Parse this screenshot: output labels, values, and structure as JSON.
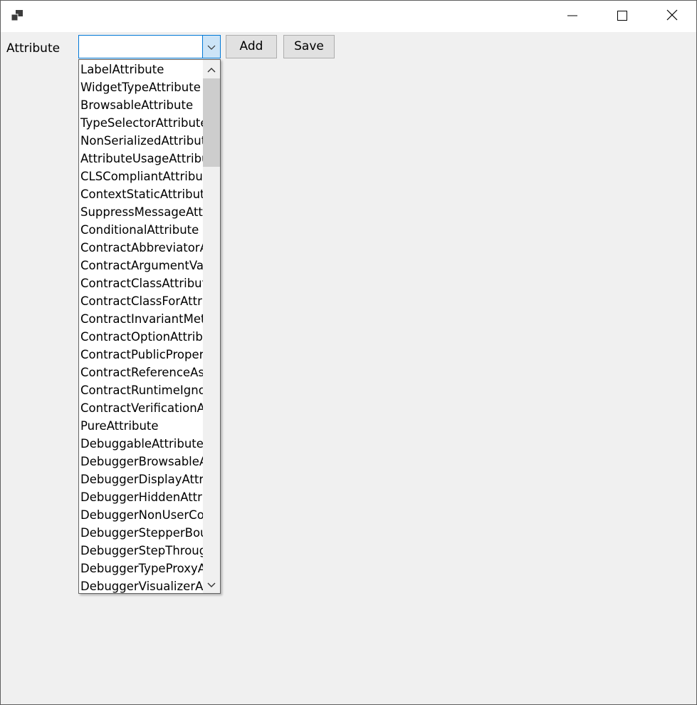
{
  "window": {
    "app_icon": "app-icon",
    "minimize_icon": "minimize-icon",
    "maximize_icon": "maximize-icon",
    "close_icon": "close-icon"
  },
  "form": {
    "attribute_label": "Attribute",
    "combo_value": "",
    "add_label": "Add",
    "save_label": "Save"
  },
  "dropdown": {
    "items": [
      "LabelAttribute",
      "WidgetTypeAttribute",
      "BrowsableAttribute",
      "TypeSelectorAttribute",
      "NonSerializedAttribut",
      "AttributeUsageAttribu",
      "CLSCompliantAttribut",
      "ContextStaticAttribute",
      "SuppressMessageAttr",
      "ConditionalAttribute",
      "ContractAbbreviatorA",
      "ContractArgumentVal",
      "ContractClassAttribute",
      "ContractClassForAttril",
      "ContractInvariantMeth",
      "ContractOptionAttribu",
      "ContractPublicPropert",
      "ContractReferenceAss",
      "ContractRuntimeIgno",
      "ContractVerificationAt",
      "PureAttribute",
      "DebuggableAttribute",
      "DebuggerBrowsableA",
      "DebuggerDisplayAttri",
      "DebuggerHiddenAttri",
      "DebuggerNonUserCo",
      "DebuggerStepperBou",
      "DebuggerStepThroug",
      "DebuggerTypeProxyA",
      "DebuggerVisualizerAt"
    ]
  },
  "colors": {
    "focus_border": "#0078d7",
    "arrow_bg": "#cce4f7",
    "button_bg": "#e1e1e1",
    "client_bg": "#f0f0f0",
    "scroll_thumb": "#cdcdcd"
  }
}
